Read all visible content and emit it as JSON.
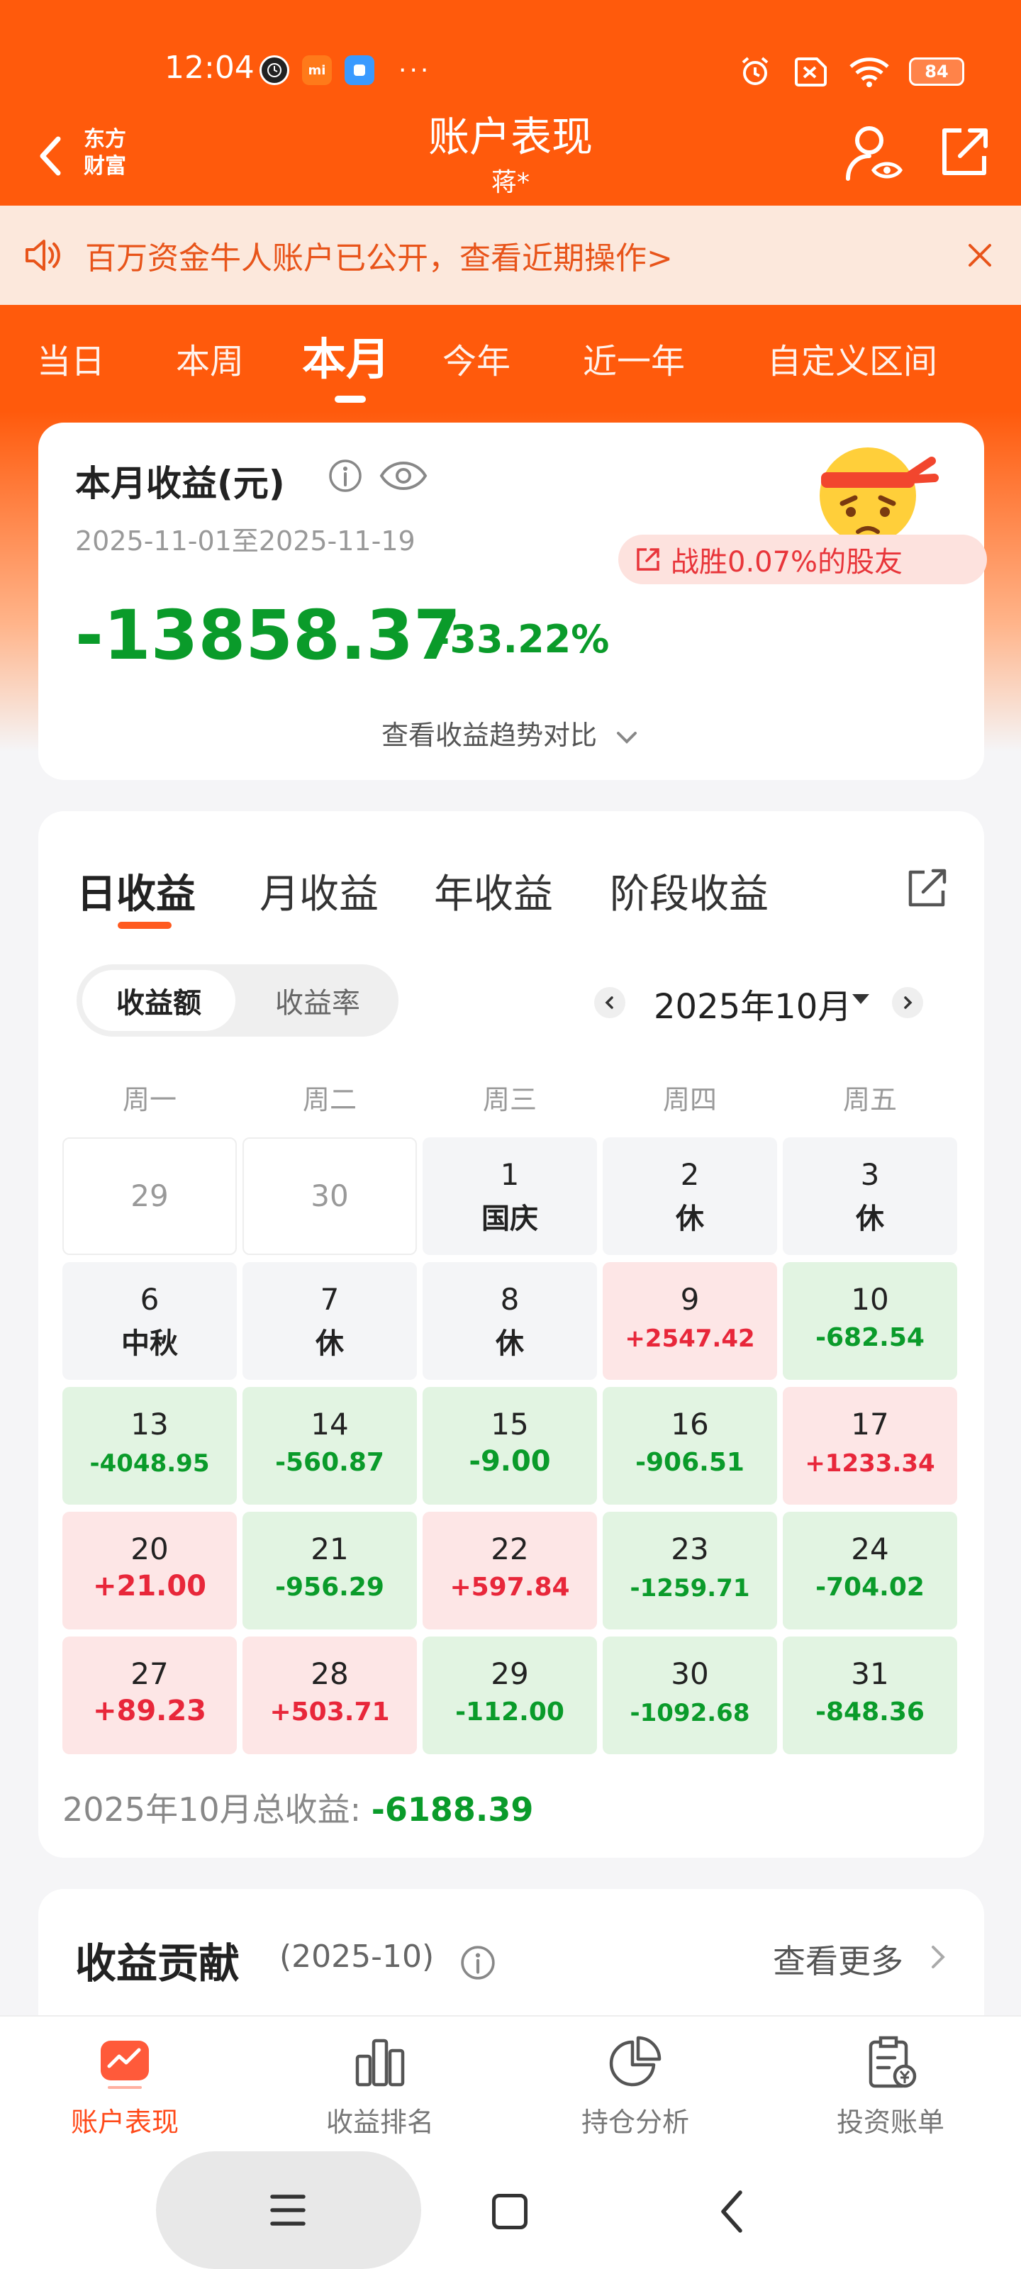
{
  "status_bar": {
    "time": "12:04",
    "battery": "84",
    "icons": [
      "clock-app-icon",
      "mi-app-icon",
      "blue-app-icon",
      "alarm-icon",
      "no-sim-icon",
      "wifi-icon",
      "battery-icon"
    ]
  },
  "header": {
    "logo_line1": "东方",
    "logo_line2": "财富",
    "title": "账户表现",
    "subtitle": "蒋*"
  },
  "notice": {
    "text": "百万资金牛人账户已公开，查看近期操作>"
  },
  "tabs": [
    "当日",
    "本周",
    "本月",
    "今年",
    "近一年",
    "自定义区间"
  ],
  "summary": {
    "title": "本月收益(元)",
    "date_range": "2025-11-01至2025-11-19",
    "amount": "-13858.37",
    "percent": "-33.22%",
    "badge": "战胜0.07%的股友",
    "compare_link": "查看收益趋势对比"
  },
  "calendar": {
    "tabs": [
      "日收益",
      "月收益",
      "年收益",
      "阶段收益"
    ],
    "toggle": [
      "收益额",
      "收益率"
    ],
    "month": "2025年10月",
    "weekdays": [
      "周一",
      "周二",
      "周三",
      "周四",
      "周五"
    ],
    "rows": [
      [
        {
          "day": "29",
          "val": "",
          "type": "empty"
        },
        {
          "day": "30",
          "val": "",
          "type": "empty"
        },
        {
          "day": "1",
          "val": "国庆",
          "type": "grey"
        },
        {
          "day": "2",
          "val": "休",
          "type": "grey"
        },
        {
          "day": "3",
          "val": "休",
          "type": "grey"
        }
      ],
      [
        {
          "day": "6",
          "val": "中秋",
          "type": "grey"
        },
        {
          "day": "7",
          "val": "休",
          "type": "grey"
        },
        {
          "day": "8",
          "val": "休",
          "type": "grey"
        },
        {
          "day": "9",
          "val": "+2547.42",
          "type": "red"
        },
        {
          "day": "10",
          "val": "-682.54",
          "type": "green"
        }
      ],
      [
        {
          "day": "13",
          "val": "-4048.95",
          "type": "green"
        },
        {
          "day": "14",
          "val": "-560.87",
          "type": "green"
        },
        {
          "day": "15",
          "val": "-9.00",
          "type": "green"
        },
        {
          "day": "16",
          "val": "-906.51",
          "type": "green"
        },
        {
          "day": "17",
          "val": "+1233.34",
          "type": "red"
        }
      ],
      [
        {
          "day": "20",
          "val": "+21.00",
          "type": "red"
        },
        {
          "day": "21",
          "val": "-956.29",
          "type": "green"
        },
        {
          "day": "22",
          "val": "+597.84",
          "type": "red"
        },
        {
          "day": "23",
          "val": "-1259.71",
          "type": "green"
        },
        {
          "day": "24",
          "val": "-704.02",
          "type": "green"
        }
      ],
      [
        {
          "day": "27",
          "val": "+89.23",
          "type": "red"
        },
        {
          "day": "28",
          "val": "+503.71",
          "type": "red"
        },
        {
          "day": "29",
          "val": "-112.00",
          "type": "green"
        },
        {
          "day": "30",
          "val": "-1092.68",
          "type": "green"
        },
        {
          "day": "31",
          "val": "-848.36",
          "type": "green"
        }
      ]
    ],
    "total_label": "2025年10月总收益: ",
    "total_value": "-6188.39"
  },
  "contribution": {
    "title": "收益贡献",
    "period": "(2025-10)",
    "more": "查看更多"
  },
  "bottom_nav": [
    "账户表现",
    "收益排名",
    "持仓分析",
    "投资账单"
  ],
  "colors": {
    "brand": "#ff5a0c",
    "profit": "#e8273a",
    "loss": "#0a9b2a"
  }
}
